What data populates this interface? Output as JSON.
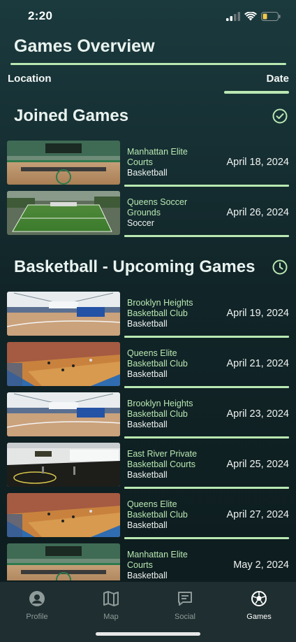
{
  "status_bar": {
    "time": "2:20"
  },
  "header": {
    "title": "Games Overview"
  },
  "sort": {
    "location_label": "Location",
    "date_label": "Date"
  },
  "joined": {
    "title": "Joined Games",
    "icon": "check-circle-icon",
    "games": [
      {
        "location": "Manhattan Elite Courts",
        "sport": "Basketball",
        "date": "April 18, 2024",
        "thumb": "indoor-court-green"
      },
      {
        "location": "Queens Soccer Grounds",
        "sport": "Soccer",
        "date": "April 26, 2024",
        "thumb": "soccer-field"
      }
    ]
  },
  "upcoming": {
    "title": "Basketball - Upcoming Games",
    "icon": "clock-icon",
    "games": [
      {
        "location": "Brooklyn Heights Basketball Club",
        "sport": "Basketball",
        "date": "April 19, 2024",
        "thumb": "gym-white"
      },
      {
        "location": "Queens Elite Basketball Club",
        "sport": "Basketball",
        "date": "April 21, 2024",
        "thumb": "arena-crowd"
      },
      {
        "location": "Brooklyn Heights Basketball Club",
        "sport": "Basketball",
        "date": "April 23, 2024",
        "thumb": "gym-white"
      },
      {
        "location": "East River Private Basketball Courts",
        "sport": "Basketball",
        "date": "April 25, 2024",
        "thumb": "private-gym"
      },
      {
        "location": "Queens Elite Basketball Club",
        "sport": "Basketball",
        "date": "April 27, 2024",
        "thumb": "arena-crowd"
      },
      {
        "location": "Manhattan Elite Courts",
        "sport": "Basketball",
        "date": "May 2, 2024",
        "thumb": "indoor-court-green"
      }
    ]
  },
  "tabs": [
    {
      "label": "Profile",
      "icon": "profile-icon",
      "active": false
    },
    {
      "label": "Map",
      "icon": "map-icon",
      "active": false
    },
    {
      "label": "Social",
      "icon": "chat-icon",
      "active": false
    },
    {
      "label": "Games",
      "icon": "soccer-ball-icon",
      "active": true
    }
  ],
  "colors": {
    "accent": "#b9e8b2",
    "background_top": "#1b3a3e",
    "background_bottom": "#0d1b1d",
    "tab_bar": "#1f2e30"
  }
}
